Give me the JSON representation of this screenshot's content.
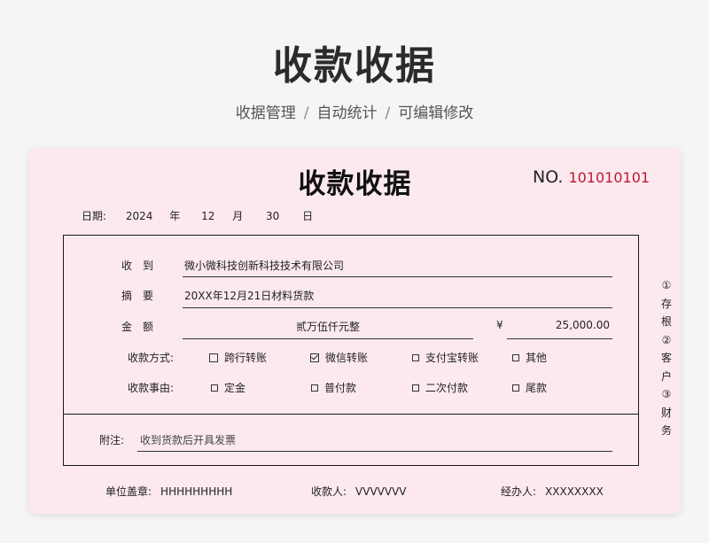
{
  "header": {
    "title": "收款收据",
    "features": [
      "收据管理",
      "自动统计",
      "可编辑修改"
    ],
    "separator": "/"
  },
  "receipt": {
    "title": "收款收据",
    "no_label": "NO.",
    "no_value": "101010101",
    "date": {
      "label": "日期:",
      "year": "2024",
      "year_unit": "年",
      "month": "12",
      "month_unit": "月",
      "day": "30",
      "day_unit": "日"
    },
    "received_from": {
      "label": "收　到",
      "value": "微小微科技创新科技技术有限公司"
    },
    "summary": {
      "label": "摘　要",
      "value": "20XX年12月21日材料货款"
    },
    "amount": {
      "label": "金　额",
      "words": "贰万伍仟元整",
      "currency": "¥",
      "number": "25,000.00"
    },
    "payment_method": {
      "label": "收款方式:",
      "options": [
        {
          "label": "跨行转账",
          "checked": false
        },
        {
          "label": "微信转账",
          "checked": true
        },
        {
          "label": "支付宝转账",
          "checked": false
        },
        {
          "label": "其他",
          "checked": false
        }
      ]
    },
    "payment_reason": {
      "label": "收款事由:",
      "options": [
        {
          "label": "定金",
          "checked": false
        },
        {
          "label": "普付款",
          "checked": false
        },
        {
          "label": "二次付款",
          "checked": false
        },
        {
          "label": "尾款",
          "checked": false
        }
      ]
    },
    "note": {
      "label": "附注:",
      "value": "收到货款后开具发票"
    },
    "side_note": [
      "①",
      "存",
      "根",
      "②",
      "客",
      "户",
      "③",
      "财",
      "务"
    ],
    "footer": {
      "seal": {
        "label": "单位盖章:",
        "value": "HHHHHHHHH"
      },
      "payee": {
        "label": "收款人:",
        "value": "VVVVVVV"
      },
      "handler": {
        "label": "经办人:",
        "value": "XXXXXXXX"
      }
    }
  }
}
